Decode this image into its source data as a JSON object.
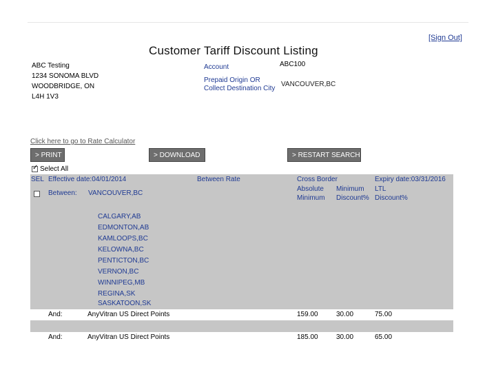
{
  "header": {
    "signout_label": "[Sign Out]",
    "title": "Customer Tariff Discount Listing"
  },
  "address": {
    "lines": [
      "ABC Testing",
      "1234 SONOMA BLVD",
      "WOODBRIDGE, ON",
      "L4H 1V3"
    ]
  },
  "account": {
    "label": "Account",
    "value": "ABC100",
    "origin_label_line1": "Prepaid Origin OR",
    "origin_label_line2": "Collect Destination City",
    "origin_value": "VANCOUVER,BC"
  },
  "rate_calculator_link": "Click here to go to Rate Calculator",
  "toolbar": {
    "print_label": "> PRINT",
    "download_label": "> DOWNLOAD",
    "restart_label": "> RESTART SEARCH"
  },
  "select_all_label": "Select All",
  "table": {
    "sel_header": "SEL",
    "effective_date": "Effective date:04/01/2014",
    "between_rate": "Between Rate",
    "cross_border": "Cross Border",
    "expiry_date": "Expiry date:03/31/2016",
    "absolute_minimum_1": "Absolute",
    "absolute_minimum_2": "Minimum",
    "minimum_discount_1": "Minimum",
    "minimum_discount_2": "Discount%",
    "ltl_discount_1": "LTL",
    "ltl_discount_2": "Discount%",
    "between_label": "Between:",
    "between_city": "VANCOUVER,BC",
    "cities": [
      "CALGARY,AB",
      "EDMONTON,AB",
      "KAMLOOPS,BC",
      "KELOWNA,BC",
      "PENTICTON,BC",
      "VERNON,BC",
      "WINNIPEG,MB",
      "REGINA,SK",
      "SASKATOON,SK"
    ],
    "rows": [
      {
        "conj": "And:",
        "points": "AnyVitran US Direct Points",
        "abs_min": "159.00",
        "min_disc": "30.00",
        "ltl_disc": "75.00"
      },
      {
        "conj": "And:",
        "points": "AnyVitran US Direct Points",
        "abs_min": "185.00",
        "min_disc": "30.00",
        "ltl_disc": "65.00"
      }
    ]
  }
}
